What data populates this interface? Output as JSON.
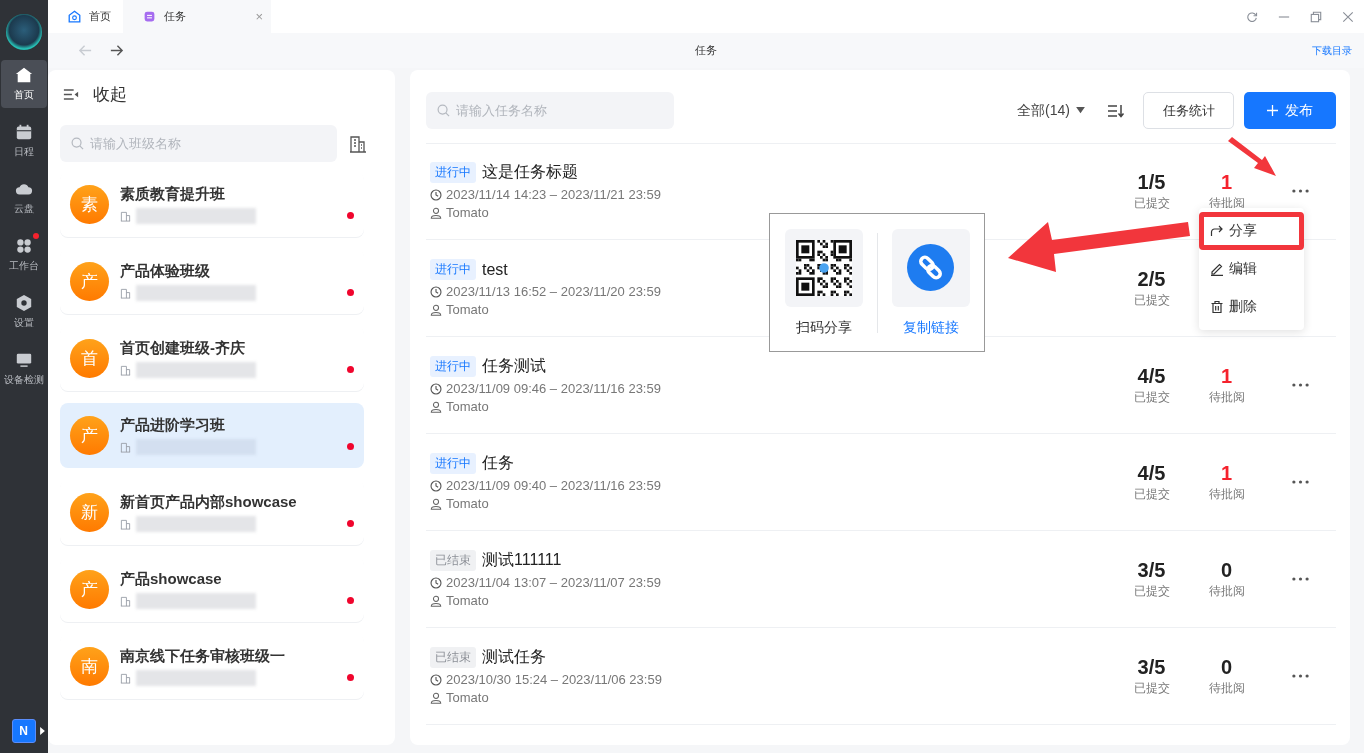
{
  "sidebar": {
    "items": [
      {
        "label": "首页",
        "selected": true,
        "badge": false
      },
      {
        "label": "日程",
        "selected": false,
        "badge": false
      },
      {
        "label": "云盘",
        "selected": false,
        "badge": false
      },
      {
        "label": "工作台",
        "selected": false,
        "badge": true
      },
      {
        "label": "设置",
        "selected": false,
        "badge": false
      },
      {
        "label": "设备检测",
        "selected": false,
        "badge": false
      }
    ],
    "bottom_logo": "N"
  },
  "tabs": [
    {
      "label": "首页",
      "selected": false
    },
    {
      "label": "任务",
      "selected": true,
      "close": "×"
    }
  ],
  "nav": {
    "back_disabled": true,
    "forward_disabled": false,
    "title": "任务",
    "link": "下载目录"
  },
  "class_panel": {
    "collapse": "收起",
    "search": {
      "placeholder": "请输入班级名称"
    },
    "classes": [
      {
        "avatar": "素",
        "name": "素质教育提升班",
        "selected": false,
        "unread": true
      },
      {
        "avatar": "产",
        "name": "产品体验班级",
        "selected": false,
        "unread": true
      },
      {
        "avatar": "首",
        "name": "首页创建班级-齐庆",
        "selected": false,
        "unread": true
      },
      {
        "avatar": "产",
        "name": "产品进阶学习班",
        "selected": true,
        "unread": true
      },
      {
        "avatar": "新",
        "name": "新首页产品内部showcase",
        "selected": false,
        "unread": true
      },
      {
        "avatar": "产",
        "name": "产品showcase",
        "selected": false,
        "unread": true
      },
      {
        "avatar": "南",
        "name": "南京线下任务审核班级一",
        "selected": false,
        "unread": true
      }
    ]
  },
  "task_panel": {
    "search": {
      "placeholder": "请输入任务名称"
    },
    "filter": "全部(14)",
    "stats_button": "任务统计",
    "publish_button": "发布",
    "tasks": [
      {
        "status": "进行中",
        "ended": false,
        "title": "这是任务标题",
        "time": "2023/11/14 14:23 – 2023/11/21 23:59",
        "owner": "Tomato",
        "submitted": "1/5",
        "submitted_label": "已提交",
        "pending": "1",
        "pending_label": "待批阅",
        "pending_alert": true
      },
      {
        "status": "进行中",
        "ended": false,
        "title": "test",
        "time": "2023/11/13 16:52 – 2023/11/20 23:59",
        "owner": "Tomato",
        "submitted": "2/5",
        "submitted_label": "已提交"
      },
      {
        "status": "进行中",
        "ended": false,
        "title": "任务测试",
        "time": "2023/11/09 09:46 – 2023/11/16 23:59",
        "owner": "Tomato",
        "submitted": "4/5",
        "submitted_label": "已提交",
        "pending": "1",
        "pending_label": "待批阅",
        "pending_alert": true
      },
      {
        "status": "进行中",
        "ended": false,
        "title": "任务",
        "time": "2023/11/09 09:40 – 2023/11/16 23:59",
        "owner": "Tomato",
        "submitted": "4/5",
        "submitted_label": "已提交",
        "pending": "1",
        "pending_label": "待批阅",
        "pending_alert": true
      },
      {
        "status": "已结束",
        "ended": true,
        "title": "测试111111",
        "time": "2023/11/04 13:07 – 2023/11/07 23:59",
        "owner": "Tomato",
        "submitted": "3/5",
        "submitted_label": "已提交",
        "pending": "0",
        "pending_label": "待批阅",
        "pending_alert": false
      },
      {
        "status": "已结束",
        "ended": true,
        "title": "测试任务",
        "time": "2023/10/30 15:24 – 2023/11/06 23:59",
        "owner": "Tomato",
        "submitted": "3/5",
        "submitted_label": "已提交",
        "pending": "0",
        "pending_label": "待批阅",
        "pending_alert": false
      }
    ]
  },
  "task_menu": {
    "items": [
      {
        "label": "分享",
        "highlighted": true
      },
      {
        "label": "编辑",
        "highlighted": false
      },
      {
        "label": "删除",
        "highlighted": false
      }
    ]
  },
  "share_popover": {
    "options": [
      {
        "label": "扫码分享",
        "kind": "qr"
      },
      {
        "label": "复制链接",
        "kind": "link"
      }
    ]
  }
}
